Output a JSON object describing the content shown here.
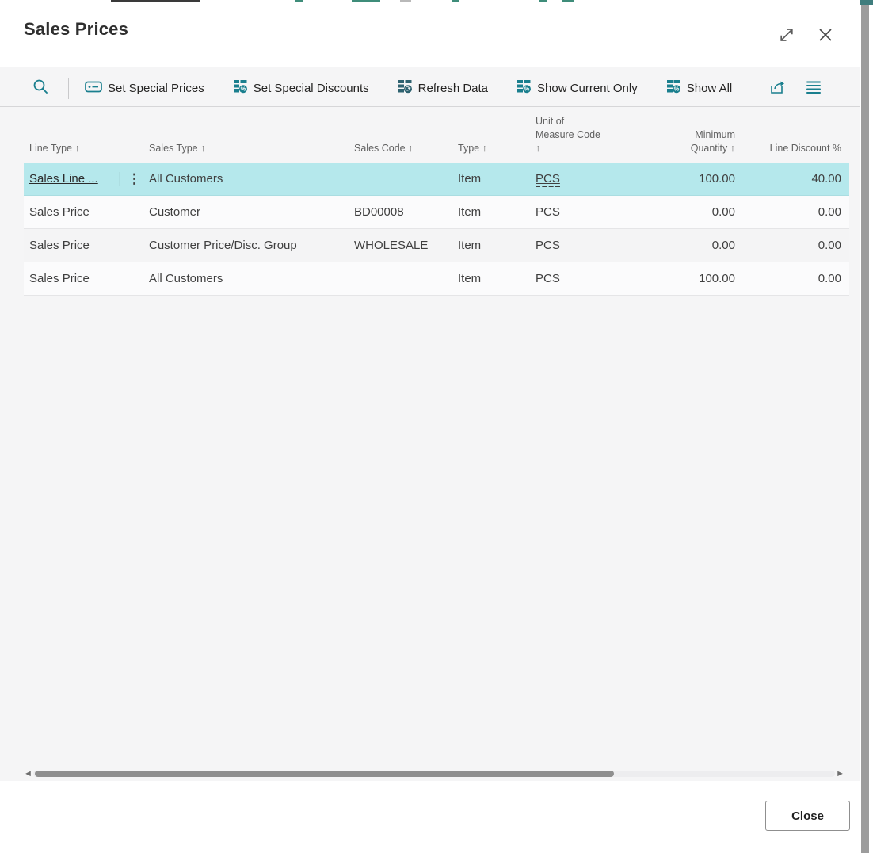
{
  "dialog": {
    "title": "Sales Prices"
  },
  "toolbar": {
    "actions": [
      {
        "label": "Set Special Prices"
      },
      {
        "label": "Set Special Discounts"
      },
      {
        "label": "Refresh Data"
      },
      {
        "label": "Show Current Only"
      },
      {
        "label": "Show All"
      }
    ]
  },
  "table": {
    "columns": [
      {
        "label": "Line Type ↑"
      },
      {
        "label": "Sales Type ↑"
      },
      {
        "label": "Sales Code ↑"
      },
      {
        "label": "Type ↑"
      },
      {
        "label": "Unit of Measure Code ↑"
      },
      {
        "label": "Minimum Quantity ↑"
      },
      {
        "label": "Line Discount %"
      }
    ],
    "rows": [
      {
        "line_type": "Sales Line ...",
        "sales_type": "All Customers",
        "sales_code": "",
        "type": "Item",
        "uom": "PCS",
        "min_qty": "100.00",
        "line_disc": "40.00",
        "selected": true
      },
      {
        "line_type": "Sales Price",
        "sales_type": "Customer",
        "sales_code": "BD00008",
        "type": "Item",
        "uom": "PCS",
        "min_qty": "0.00",
        "line_disc": "0.00",
        "selected": false
      },
      {
        "line_type": "Sales Price",
        "sales_type": "Customer Price/Disc. Group",
        "sales_code": "WHOLESALE",
        "type": "Item",
        "uom": "PCS",
        "min_qty": "0.00",
        "line_disc": "0.00",
        "selected": false
      },
      {
        "line_type": "Sales Price",
        "sales_type": "All Customers",
        "sales_code": "",
        "type": "Item",
        "uom": "PCS",
        "min_qty": "100.00",
        "line_disc": "0.00",
        "selected": false
      }
    ]
  },
  "icons": {
    "row_menu": "⋮",
    "scroll_left": "◄",
    "scroll_right": "►"
  },
  "footer": {
    "close_label": "Close"
  },
  "colors": {
    "accent_teal": "#1A7F8E",
    "selected_row": "#B5E8EC",
    "refresh_icon": "#2E6270"
  }
}
